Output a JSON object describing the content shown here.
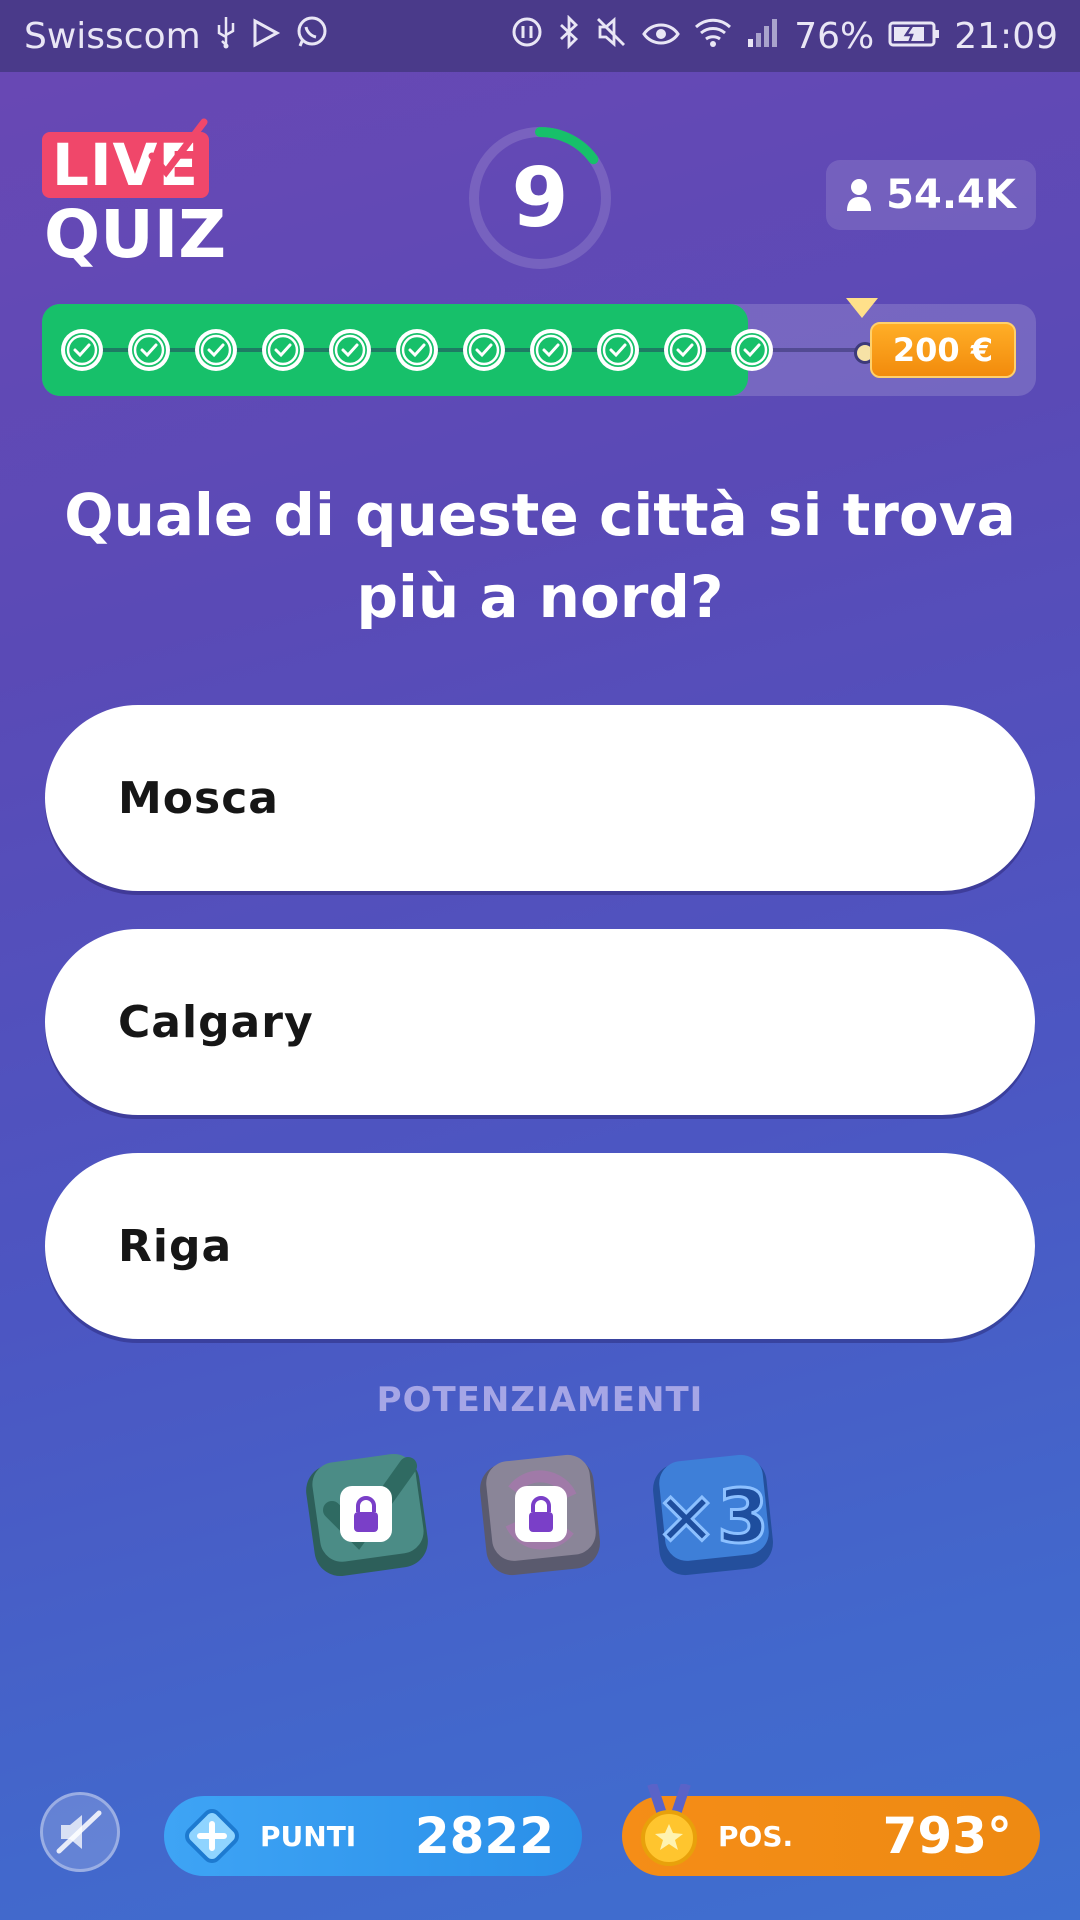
{
  "status_bar": {
    "carrier": "Swisscom",
    "battery": "76%",
    "time": "21:09"
  },
  "logo": {
    "top": "LIVE",
    "bottom": "QUIZ"
  },
  "timer": {
    "seconds": "9",
    "remaining_fraction": 0.15
  },
  "viewers": {
    "count": "54.4K"
  },
  "progress": {
    "answered": 11,
    "completed_fraction": 0.71,
    "prize": "200 €"
  },
  "question": "Quale di queste città si trova più a nord?",
  "answers": [
    {
      "label": "Mosca"
    },
    {
      "label": "Calgary"
    },
    {
      "label": "Riga"
    }
  ],
  "powerups": {
    "title": "POTENZIAMENTI",
    "items": [
      {
        "icon": "check-powerup-icon",
        "locked": true
      },
      {
        "icon": "swap-powerup-icon",
        "locked": true
      },
      {
        "icon": "x3-powerup-icon",
        "locked": false,
        "label": "×3"
      }
    ]
  },
  "bottom": {
    "points_label": "PUNTI",
    "points_value": "2822",
    "pos_label": "POS.",
    "pos_value": "793°"
  },
  "colors": {
    "accent_green": "#17c06a",
    "live_red": "#f0476a",
    "prize_orange": "#f28b0c",
    "points_blue": "#3ea4f5",
    "pos_orange": "#ee8a12"
  }
}
